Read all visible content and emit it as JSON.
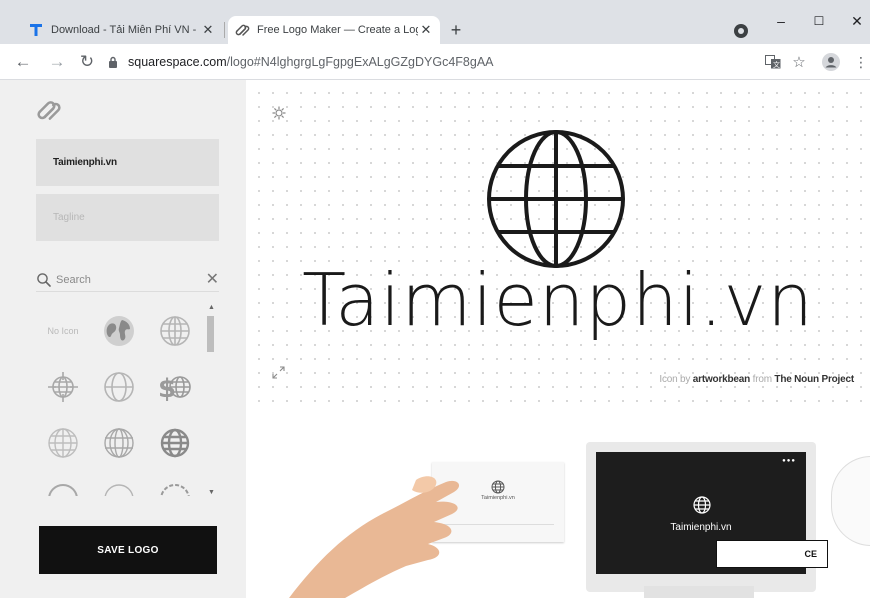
{
  "browser": {
    "tabs": [
      {
        "title": "Download - Tải Miễn Phí VN - Pł",
        "active": false,
        "close": "✕"
      },
      {
        "title": "Free Logo Maker — Create a Log",
        "active": true,
        "close": "✕"
      }
    ],
    "new_tab": "+",
    "window_controls": {
      "minimize": "–",
      "maximize": "☐",
      "close": "✕"
    },
    "url_host": "squarespace.com",
    "url_path": "/logo#N4lghgrgLgFgpgExALgGZgDYGc4F8gAA",
    "nav": {
      "back": "←",
      "forward": "→",
      "reload": "↻"
    },
    "toolbar_icons": [
      "translate-icon",
      "star-icon",
      "profile-icon",
      "menu-icon"
    ]
  },
  "sidebar": {
    "business_name": "Taimienphi.vn",
    "tagline_placeholder": "Tagline",
    "search_placeholder": "Search",
    "search_clear": "✕",
    "icons": [
      {
        "name": "no-icon",
        "label": "No Icon"
      },
      {
        "name": "earth-icon"
      },
      {
        "name": "globe-icon"
      },
      {
        "name": "target-globe-icon"
      },
      {
        "name": "globe-outline-icon"
      },
      {
        "name": "dollar-globe-icon"
      },
      {
        "name": "grid-globe-icon"
      },
      {
        "name": "striped-globe-icon"
      },
      {
        "name": "bold-globe-icon"
      }
    ],
    "save_label": "SAVE LOGO"
  },
  "canvas": {
    "logo_text": "Taimienphi.vn",
    "credit_prefix": "Icon by ",
    "credit_author": "artworkbean",
    "credit_middle": " from ",
    "credit_source": "The Noun Project"
  },
  "mockups": {
    "card_name": "Taimienphi.vn",
    "screen_name": "Taimienphi.vn",
    "screen_dots": "●●●",
    "cta_partial": "CE"
  },
  "colors": {
    "accent": "#111111",
    "sidebar_bg": "#f0f0f0",
    "field_bg": "#e0e0e0",
    "tabstrip": "#dee1e6"
  }
}
